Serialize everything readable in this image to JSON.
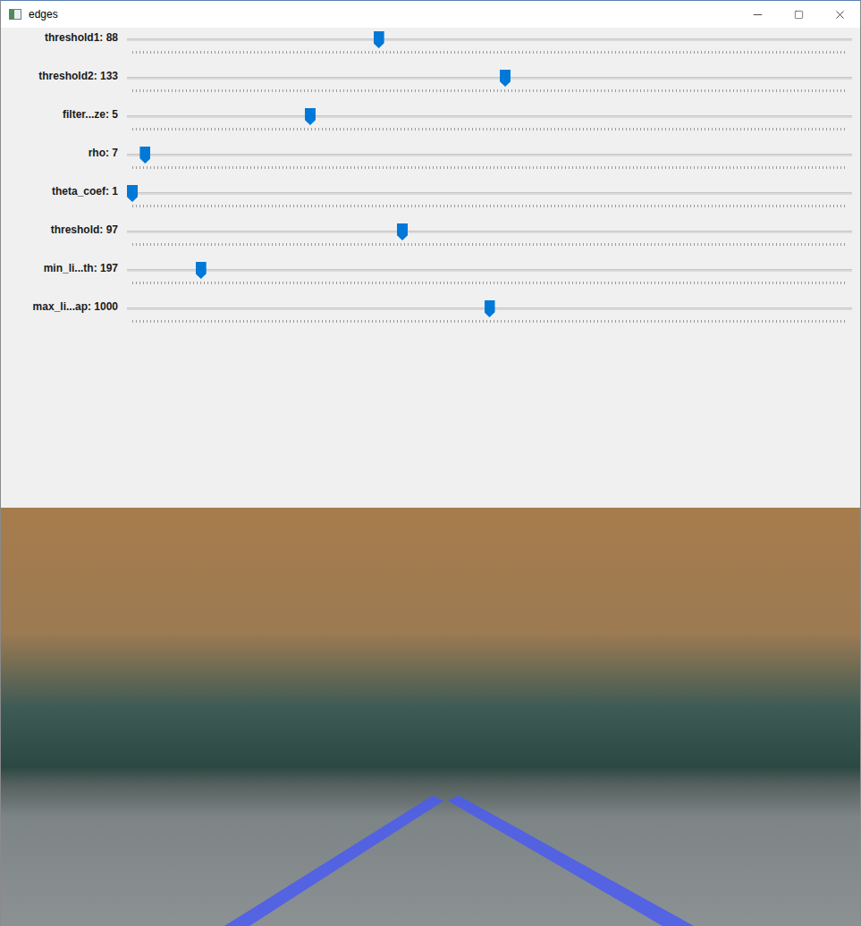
{
  "window": {
    "title": "edges",
    "controls": [
      {
        "action": "minimize"
      },
      {
        "action": "maximize"
      },
      {
        "action": "close"
      }
    ]
  },
  "trackbars": [
    {
      "label": "threshold1: 88",
      "level": 0.345
    },
    {
      "label": "threshold2: 133",
      "level": 0.522
    },
    {
      "label": "filter...ze: 5",
      "level": 0.249
    },
    {
      "label": "rho: 7",
      "level": 0.018
    },
    {
      "label": "theta_coef: 1",
      "level": 0.0
    },
    {
      "label": "threshold: 97",
      "level": 0.378
    },
    {
      "label": "min_li...th: 197",
      "level": 0.096
    },
    {
      "label": "max_li...ap: 1000",
      "level": 0.5
    }
  ]
}
